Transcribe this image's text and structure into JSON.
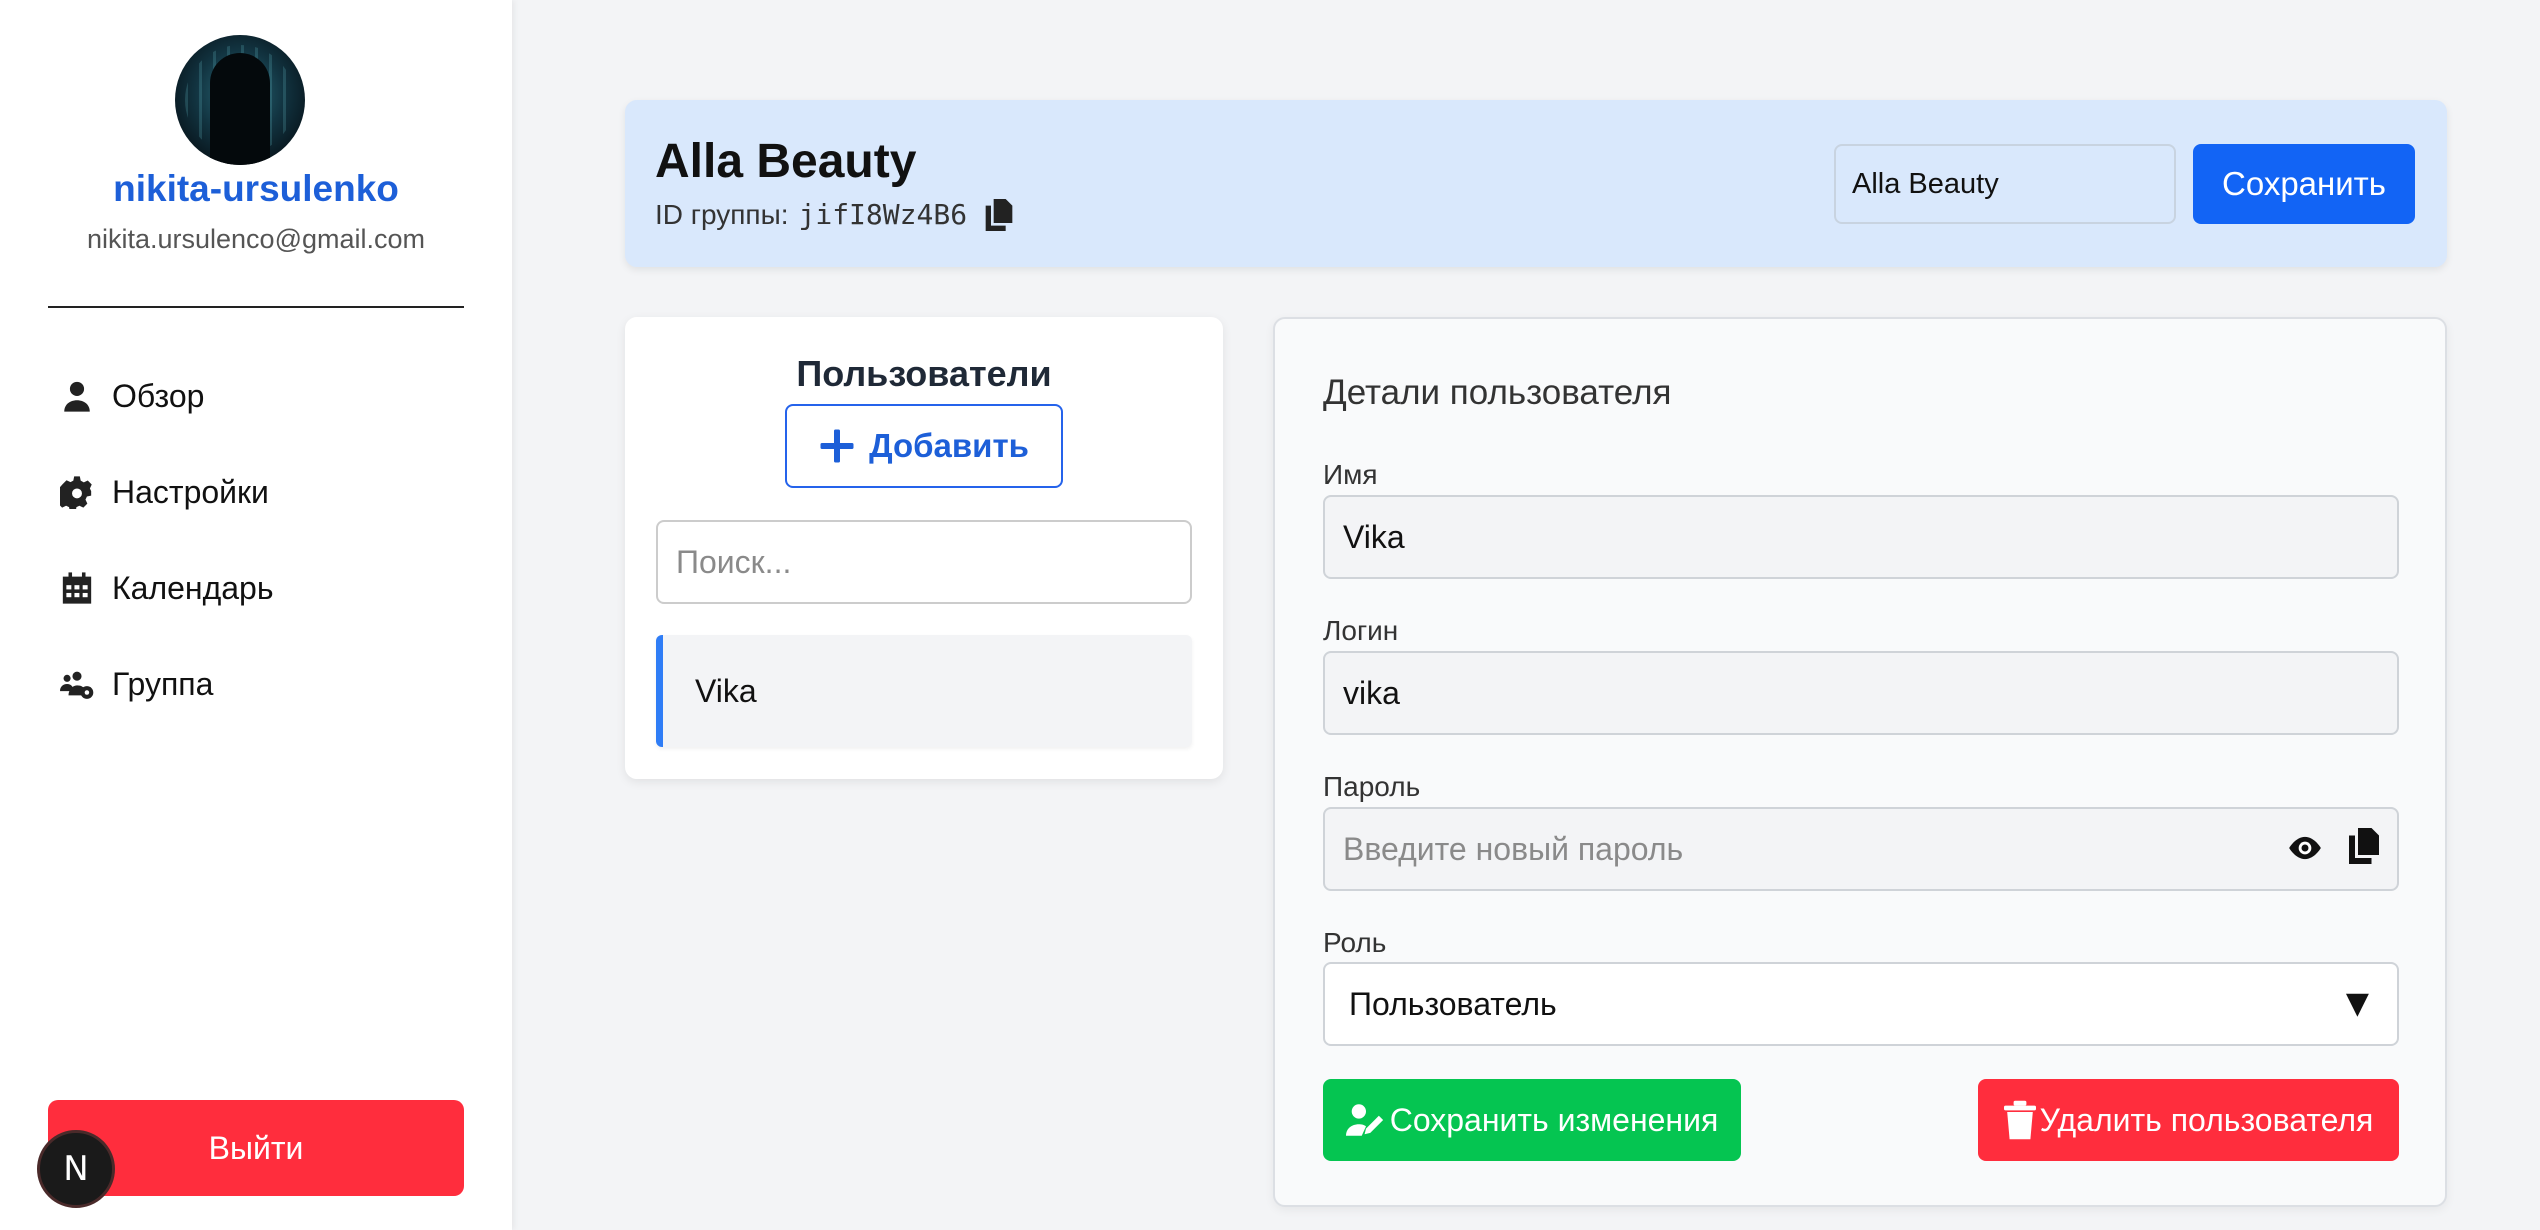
{
  "sidebar": {
    "username": "nikita-ursulenko",
    "email": "nikita.ursulenco@gmail.com",
    "items": [
      {
        "label": "Обзор",
        "icon": "user-icon"
      },
      {
        "label": "Настройки",
        "icon": "gear-icon"
      },
      {
        "label": "Календарь",
        "icon": "calendar-icon"
      },
      {
        "label": "Группа",
        "icon": "users-gear-icon"
      }
    ],
    "logout_label": "Выйти",
    "next_badge": "N"
  },
  "header": {
    "title": "Alla Beauty",
    "group_id_label": "ID группы:",
    "group_id": "jifI8Wz4B6",
    "name_input_value": "Alla Beauty",
    "save_label": "Сохранить"
  },
  "users_panel": {
    "title": "Пользователи",
    "add_label": "Добавить",
    "search_placeholder": "Поиск...",
    "users": [
      "Vika"
    ]
  },
  "details": {
    "title": "Детали пользователя",
    "name_label": "Имя",
    "name_value": "Vika",
    "login_label": "Логин",
    "login_value": "vika",
    "password_label": "Пароль",
    "password_placeholder": "Введите новый пароль",
    "role_label": "Роль",
    "role_value": "Пользователь",
    "role_arrow": "▼",
    "save_changes_label": "Сохранить изменения",
    "delete_label": "Удалить пользователя"
  },
  "colors": {
    "primary": "#1264f5",
    "danger": "#ff2d3d",
    "success": "#05c551",
    "header_bg": "#d9e8fc",
    "accent_link": "#1d5fd8"
  }
}
